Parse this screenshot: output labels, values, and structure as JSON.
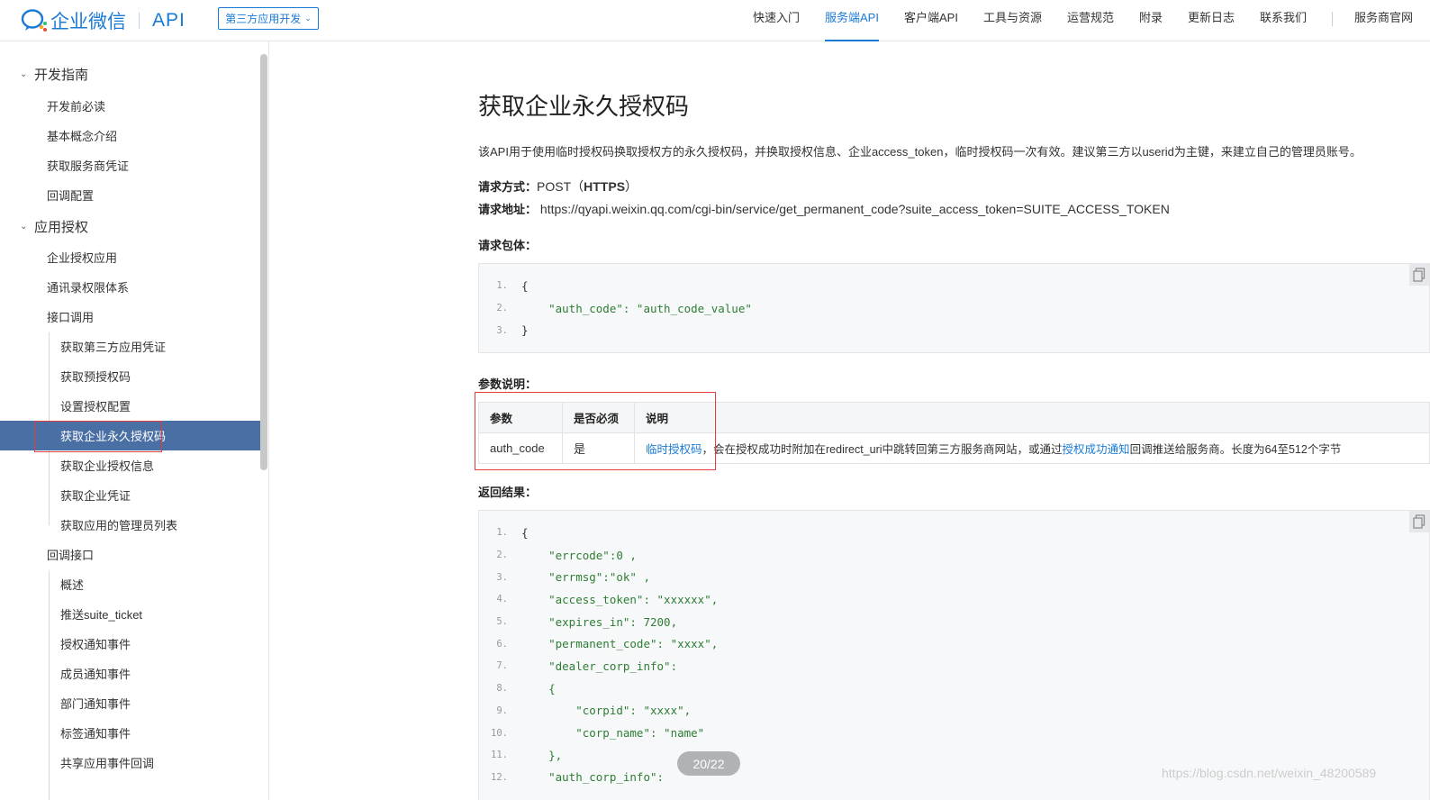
{
  "header": {
    "logo_text": "企业微信",
    "api_text": "API",
    "dev_select": "第三方应用开发",
    "nav": [
      {
        "label": "快速入门",
        "active": false
      },
      {
        "label": "服务端API",
        "active": true
      },
      {
        "label": "客户端API",
        "active": false
      },
      {
        "label": "工具与资源",
        "active": false
      },
      {
        "label": "运营规范",
        "active": false
      },
      {
        "label": "附录",
        "active": false
      },
      {
        "label": "更新日志",
        "active": false
      },
      {
        "label": "联系我们",
        "active": false
      }
    ],
    "nav_extra": "服务商官网"
  },
  "sidebar": {
    "items": [
      {
        "label": "开发指南",
        "level": 0
      },
      {
        "label": "开发前必读",
        "level": 1
      },
      {
        "label": "基本概念介绍",
        "level": 1
      },
      {
        "label": "获取服务商凭证",
        "level": 1
      },
      {
        "label": "回调配置",
        "level": 1
      },
      {
        "label": "应用授权",
        "level": 0
      },
      {
        "label": "企业授权应用",
        "level": 1
      },
      {
        "label": "通讯录权限体系",
        "level": 1
      },
      {
        "label": "接口调用",
        "level": 1
      },
      {
        "label": "获取第三方应用凭证",
        "level": 2
      },
      {
        "label": "获取预授权码",
        "level": 2
      },
      {
        "label": "设置授权配置",
        "level": 2
      },
      {
        "label": "获取企业永久授权码",
        "level": 2,
        "active": true
      },
      {
        "label": "获取企业授权信息",
        "level": 2
      },
      {
        "label": "获取企业凭证",
        "level": 2
      },
      {
        "label": "获取应用的管理员列表",
        "level": 2
      },
      {
        "label": "回调接口",
        "level": 1
      },
      {
        "label": "概述",
        "level": 2
      },
      {
        "label": "推送suite_ticket",
        "level": 2
      },
      {
        "label": "授权通知事件",
        "level": 2
      },
      {
        "label": "成员通知事件",
        "level": 2
      },
      {
        "label": "部门通知事件",
        "level": 2
      },
      {
        "label": "标签通知事件",
        "level": 2
      },
      {
        "label": "共享应用事件回调",
        "level": 2
      }
    ]
  },
  "main": {
    "title": "获取企业永久授权码",
    "intro": "该API用于使用临时授权码换取授权方的永久授权码，并换取授权信息、企业access_token，临时授权码一次有效。建议第三方以userid为主键，来建立自己的管理员账号。",
    "method_label": "请求方式：",
    "method_value": "POST（",
    "method_https": "HTTPS",
    "method_close": "）",
    "url_label": "请求地址：",
    "url_value": "https://qyapi.weixin.qq.com/cgi-bin/service/get_permanent_code?suite_access_token=SUITE_ACCESS_TOKEN",
    "body_label": "请求包体：",
    "request_code": [
      {
        "n": "1.",
        "text": "{"
      },
      {
        "n": "2.",
        "text": "    \"auth_code\": \"auth_code_value\""
      },
      {
        "n": "3.",
        "text": "}"
      }
    ],
    "params_label": "参数说明：",
    "params_headers": [
      "参数",
      "是否必须",
      "说明"
    ],
    "params_rows": [
      {
        "name": "auth_code",
        "required": "是",
        "desc_link1": "临时授权码",
        "desc_mid": "，会在授权成功时附加在redirect_uri中跳转回第三方服务商网站，或通过",
        "desc_link2": "授权成功通知",
        "desc_tail": "回调推送给服务商。长度为64至512个字节"
      }
    ],
    "result_label": "返回结果：",
    "response_code": [
      {
        "n": "1.",
        "text": "{"
      },
      {
        "n": "2.",
        "text": "    \"errcode\":0 ,"
      },
      {
        "n": "3.",
        "text": "    \"errmsg\":\"ok\" ,"
      },
      {
        "n": "4.",
        "text": "    \"access_token\": \"xxxxxx\","
      },
      {
        "n": "5.",
        "text": "    \"expires_in\": 7200,"
      },
      {
        "n": "6.",
        "text": "    \"permanent_code\": \"xxxx\","
      },
      {
        "n": "7.",
        "text": "    \"dealer_corp_info\":"
      },
      {
        "n": "8.",
        "text": "    {"
      },
      {
        "n": "9.",
        "text": "        \"corpid\": \"xxxx\","
      },
      {
        "n": "10.",
        "text": "        \"corp_name\": \"name\""
      },
      {
        "n": "11.",
        "text": "    },"
      },
      {
        "n": "12.",
        "text": "    \"auth_corp_info\":"
      }
    ]
  },
  "overlay": {
    "page_indicator": "20/22",
    "watermark": "https://blog.csdn.net/weixin_48200589"
  },
  "colors": {
    "brand": "#1a7ad4",
    "active_sidebar": "#4a6fa5",
    "highlight_box": "#e23c3c"
  }
}
